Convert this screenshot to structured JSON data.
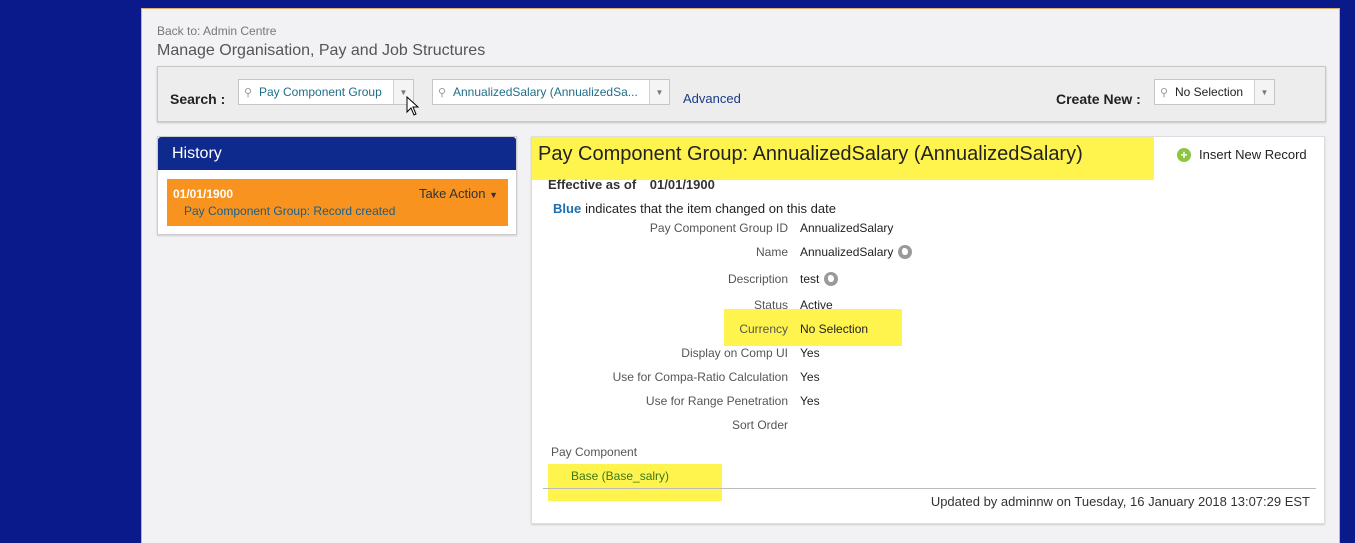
{
  "header": {
    "back_link": "Back to: Admin Centre",
    "title": "Manage Organisation, Pay and Job Structures"
  },
  "toolbar": {
    "search_label": "Search :",
    "search_type": "Pay Component Group",
    "search_value": "AnnualizedSalary (AnnualizedSa...",
    "advanced_label": "Advanced",
    "create_new_label": "Create New :",
    "create_new_value": "No Selection"
  },
  "history": {
    "title": "History",
    "items": [
      {
        "date": "01/01/1900",
        "action_label": "Take Action",
        "description": "Pay Component Group: Record created"
      }
    ]
  },
  "detail": {
    "title": "Pay Component Group: AnnualizedSalary (AnnualizedSalary)",
    "insert_label": "Insert New Record",
    "effective_label": "Effective as of",
    "effective_date": "01/01/1900",
    "legend_keyword": "Blue",
    "legend_text": "indicates that the item changed on this date",
    "fields": [
      {
        "label": "Pay Component Group ID",
        "value": "AnnualizedSalary"
      },
      {
        "label": "Name",
        "value": "AnnualizedSalary"
      },
      {
        "label": "Description",
        "value": "test"
      },
      {
        "label": "Status",
        "value": "Active"
      },
      {
        "label": "Currency",
        "value": "No Selection"
      },
      {
        "label": "Display on Comp UI",
        "value": "Yes"
      },
      {
        "label": "Use for Compa-Ratio Calculation",
        "value": "Yes"
      },
      {
        "label": "Use for Range Penetration",
        "value": "Yes"
      },
      {
        "label": "Sort Order",
        "value": ""
      }
    ],
    "pay_component_label": "Pay Component",
    "pay_component_value": "Base (Base_salry)",
    "updated_text": "Updated by adminnw on Tuesday, 16 January 2018 13:07:29 EST"
  },
  "colors": {
    "background": "#0a1a8a",
    "history_header": "#0d2a8c",
    "history_item": "#f7931e",
    "highlight": "#fff34d",
    "link": "#1a3a8a"
  }
}
